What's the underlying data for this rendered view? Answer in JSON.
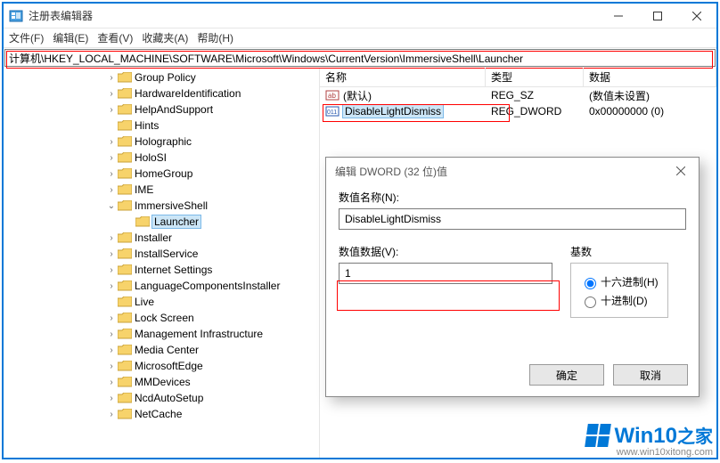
{
  "window": {
    "title": "注册表编辑器",
    "menus": {
      "file": "文件(F)",
      "edit": "编辑(E)",
      "view": "查看(V)",
      "fav": "收藏夹(A)",
      "help": "帮助(H)"
    },
    "address": "计算机\\HKEY_LOCAL_MACHINE\\SOFTWARE\\Microsoft\\Windows\\CurrentVersion\\ImmersiveShell\\Launcher"
  },
  "tree": {
    "items": [
      "Group Policy",
      "HardwareIdentification",
      "HelpAndSupport",
      "Hints",
      "Holographic",
      "HoloSI",
      "HomeGroup",
      "IME",
      "ImmersiveShell",
      "Launcher",
      "Installer",
      "InstallService",
      "Internet Settings",
      "LanguageComponentsInstaller",
      "Live",
      "Lock Screen",
      "Management Infrastructure",
      "Media Center",
      "MicrosoftEdge",
      "MMDevices",
      "NcdAutoSetup",
      "NetCache"
    ]
  },
  "columns": {
    "name": "名称",
    "type": "类型",
    "data": "数据"
  },
  "values": {
    "r0": {
      "name": "(默认)",
      "type": "REG_SZ",
      "data": "(数值未设置)"
    },
    "r1": {
      "name": "DisableLightDismiss",
      "type": "REG_DWORD",
      "data": "0x00000000 (0)"
    }
  },
  "dialog": {
    "title": "编辑 DWORD (32 位)值",
    "nameLabel": "数值名称(N):",
    "nameValue": "DisableLightDismiss",
    "dataLabel": "数值数据(V):",
    "dataValue": "1",
    "baseLabel": "基数",
    "hex": "十六进制(H)",
    "dec": "十进制(D)",
    "ok": "确定",
    "cancel": "取消"
  },
  "watermark": {
    "brand": "Win10",
    "brandSuffix": "之家",
    "url": "www.win10xitong.com"
  }
}
